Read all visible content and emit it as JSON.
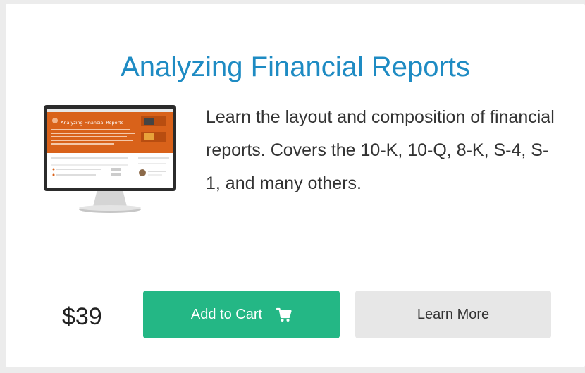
{
  "product": {
    "title": "Analyzing Financial Reports",
    "description": "Learn the layout and composition of financial reports. Covers the 10-K, 10-Q, 8-K, S-4, S-1, and many others.",
    "price": "$39",
    "image_title": "Analyzing Financial Reports"
  },
  "actions": {
    "add_to_cart_label": "Add to Cart",
    "learn_more_label": "Learn More"
  },
  "icons": {
    "cart": "shopping-cart-icon"
  },
  "colors": {
    "title": "#1e8bc3",
    "add_to_cart": "#24b785",
    "learn_more": "#e7e7e7",
    "course_banner": "#d9621a"
  }
}
